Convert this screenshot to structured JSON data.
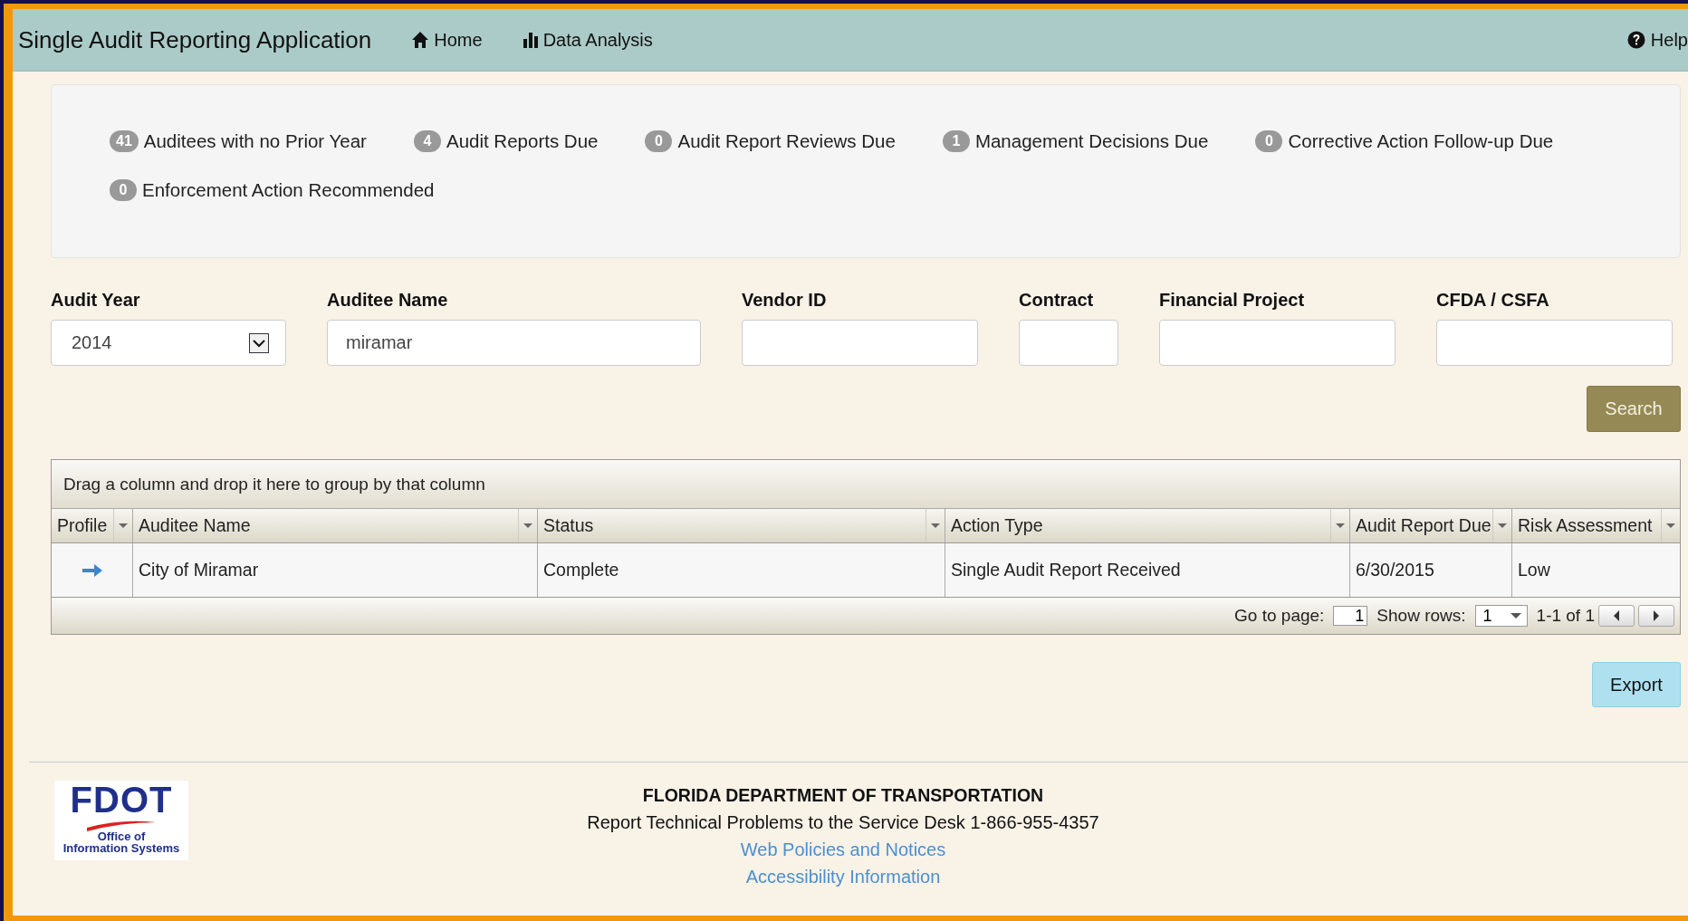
{
  "navbar": {
    "title": "Single Audit Reporting Application",
    "links": [
      {
        "label": "Home",
        "kind": "home"
      },
      {
        "label": "Data Analysis",
        "kind": "chart"
      }
    ],
    "help": {
      "label": "Help",
      "kind": "question"
    }
  },
  "badges": [
    {
      "count": "41",
      "label": "Auditees with no Prior Year"
    },
    {
      "count": "4",
      "label": "Audit Reports Due"
    },
    {
      "count": "0",
      "label": "Audit Report Reviews Due"
    },
    {
      "count": "1",
      "label": "Management Decisions Due"
    },
    {
      "count": "0",
      "label": "Corrective Action Follow-up Due"
    },
    {
      "count": "0",
      "label": "Enforcement Action Recommended"
    }
  ],
  "filters": [
    {
      "label": "Audit Year",
      "kind": "select",
      "value": "2014"
    },
    {
      "label": "Auditee Name",
      "kind": "text",
      "value": "miramar"
    },
    {
      "label": "Vendor ID",
      "kind": "text"
    },
    {
      "label": "Contract",
      "kind": "text"
    },
    {
      "label": "Financial Project",
      "kind": "text"
    },
    {
      "label": "CFDA / CSFA",
      "kind": "text"
    }
  ],
  "search_button": "Search",
  "grid": {
    "group_hint": "Drag a column and drop it here to group by that column",
    "columns": [
      "Profile",
      "Auditee Name",
      "Status",
      "Action Type",
      "Audit Report Due",
      "Risk Assessment"
    ],
    "rows": [
      {
        "cells": [
          "",
          "City of Miramar",
          "Complete",
          "Single Audit Report Received",
          "6/30/2015",
          "Low"
        ]
      }
    ],
    "pager": {
      "go_to_page_label": "Go to page:",
      "page": "1",
      "show_rows_label": "Show rows:",
      "rows": "1",
      "range": "1-1 of 1"
    }
  },
  "export_button": "Export",
  "footer": {
    "logo": {
      "name": "FDOT",
      "subtitle_1": "Office of",
      "subtitle_2": "Information Systems"
    },
    "title": "FLORIDA DEPARTMENT OF TRANSPORTATION",
    "support": "Report Technical Problems to the Service Desk 1-866-955-4357",
    "links": [
      "Web Policies and Notices",
      "Accessibility Information"
    ]
  }
}
